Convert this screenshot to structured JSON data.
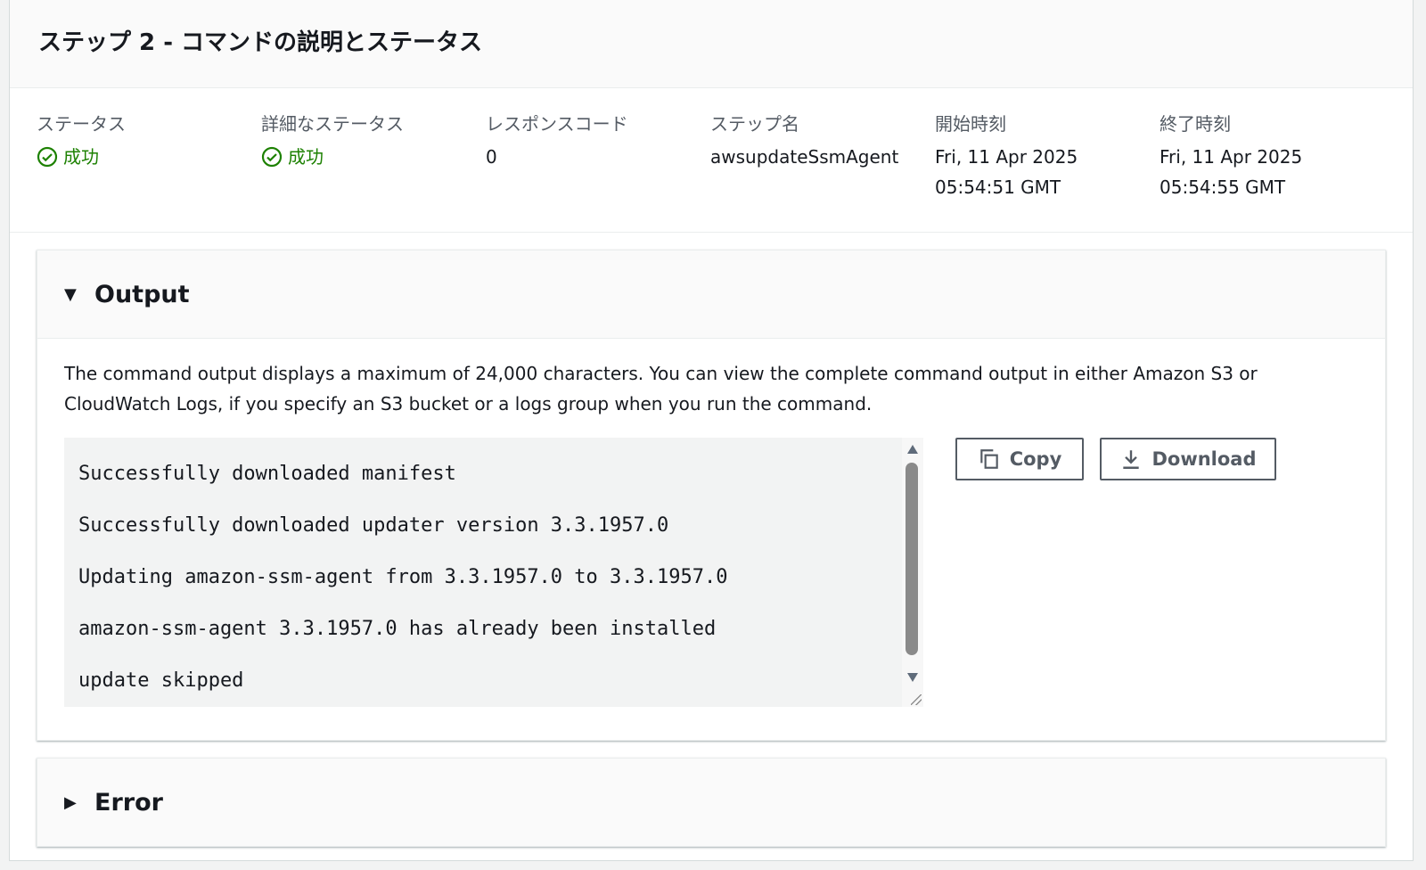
{
  "panel": {
    "title": "ステップ 2 - コマンドの説明とステータス"
  },
  "status_row": {
    "status": {
      "label": "ステータス",
      "value": "成功"
    },
    "detailed_status": {
      "label": "詳細なステータス",
      "value": "成功"
    },
    "response_code": {
      "label": "レスポンスコード",
      "value": "0"
    },
    "step_name": {
      "label": "ステップ名",
      "value": "awsupdateSsmAgent"
    },
    "start_time": {
      "label": "開始時刻",
      "line1": "Fri, 11 Apr 2025",
      "line2": "05:54:51 GMT"
    },
    "end_time": {
      "label": "終了時刻",
      "line1": "Fri, 11 Apr 2025",
      "line2": "05:54:55 GMT"
    }
  },
  "output_section": {
    "title": "Output",
    "expanded": true,
    "description": "The command output displays a maximum of 24,000 characters. You can view the complete command output in either Amazon S3 or CloudWatch Logs, if you specify an S3 bucket or a logs group when you run the command.",
    "lines": [
      "Successfully downloaded manifest",
      "Successfully downloaded updater version 3.3.1957.0",
      "Updating amazon-ssm-agent from 3.3.1957.0 to 3.3.1957.0",
      "amazon-ssm-agent 3.3.1957.0 has already been installed",
      "update skipped"
    ],
    "copy_label": "Copy",
    "download_label": "Download"
  },
  "error_section": {
    "title": "Error",
    "expanded": false
  },
  "colors": {
    "success": "#1d8102",
    "button_border": "#545b64",
    "console_bg": "#f2f3f3"
  },
  "icons": {
    "status_ok": "check-circle-icon",
    "copy": "copy-icon",
    "download": "download-icon",
    "expanded": "caret-down-icon",
    "collapsed": "caret-right-icon"
  }
}
